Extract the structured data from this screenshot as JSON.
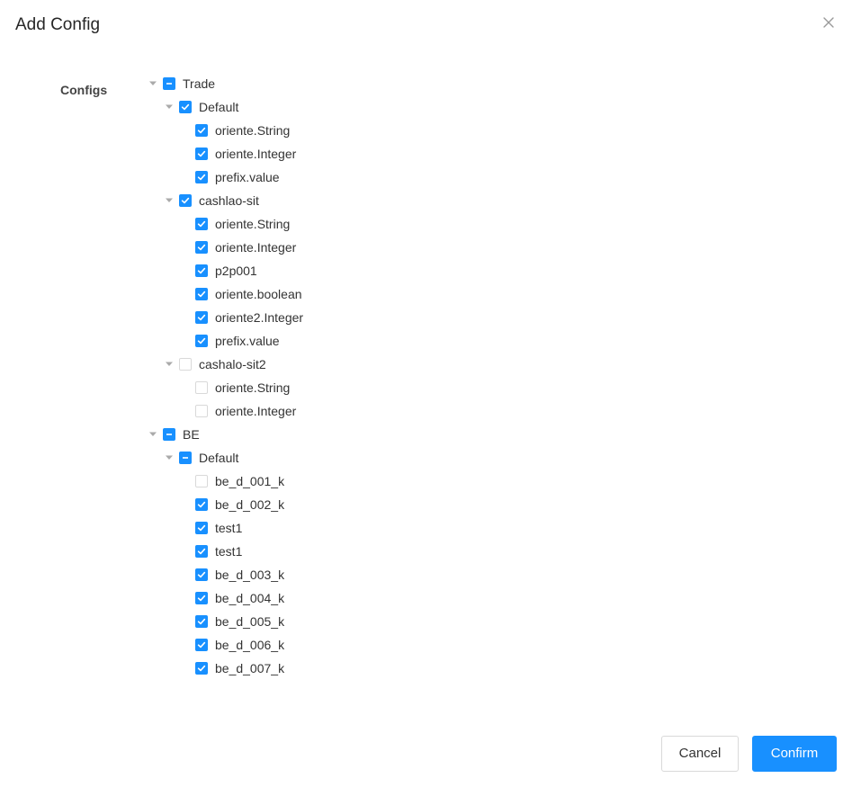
{
  "dialog": {
    "title": "Add Config",
    "close_icon": "close-icon"
  },
  "form": {
    "label": "Configs"
  },
  "tree": [
    {
      "label": "Trade",
      "state": "indeterminate",
      "expanded": true,
      "children": [
        {
          "label": "Default",
          "state": "checked",
          "expanded": true,
          "children": [
            {
              "label": "oriente.String",
              "state": "checked"
            },
            {
              "label": "oriente.Integer",
              "state": "checked"
            },
            {
              "label": "prefix.value",
              "state": "checked"
            }
          ]
        },
        {
          "label": "cashlao-sit",
          "state": "checked",
          "expanded": true,
          "children": [
            {
              "label": "oriente.String",
              "state": "checked"
            },
            {
              "label": "oriente.Integer",
              "state": "checked"
            },
            {
              "label": "p2p001",
              "state": "checked"
            },
            {
              "label": "oriente.boolean",
              "state": "checked"
            },
            {
              "label": "oriente2.Integer",
              "state": "checked"
            },
            {
              "label": "prefix.value",
              "state": "checked"
            }
          ]
        },
        {
          "label": "cashalo-sit2",
          "state": "unchecked",
          "expanded": true,
          "children": [
            {
              "label": "oriente.String",
              "state": "unchecked"
            },
            {
              "label": "oriente.Integer",
              "state": "unchecked"
            }
          ]
        }
      ]
    },
    {
      "label": "BE",
      "state": "indeterminate",
      "expanded": true,
      "children": [
        {
          "label": "Default",
          "state": "indeterminate",
          "expanded": true,
          "children": [
            {
              "label": "be_d_001_k",
              "state": "unchecked"
            },
            {
              "label": "be_d_002_k",
              "state": "checked"
            },
            {
              "label": "test1",
              "state": "checked"
            },
            {
              "label": "test1",
              "state": "checked"
            },
            {
              "label": "be_d_003_k",
              "state": "checked"
            },
            {
              "label": "be_d_004_k",
              "state": "checked"
            },
            {
              "label": "be_d_005_k",
              "state": "checked"
            },
            {
              "label": "be_d_006_k",
              "state": "checked"
            },
            {
              "label": "be_d_007_k",
              "state": "checked"
            }
          ]
        }
      ]
    }
  ],
  "footer": {
    "cancel_label": "Cancel",
    "confirm_label": "Confirm"
  },
  "colors": {
    "primary": "#1890ff",
    "border": "#d9d9d9",
    "text": "#333333"
  }
}
